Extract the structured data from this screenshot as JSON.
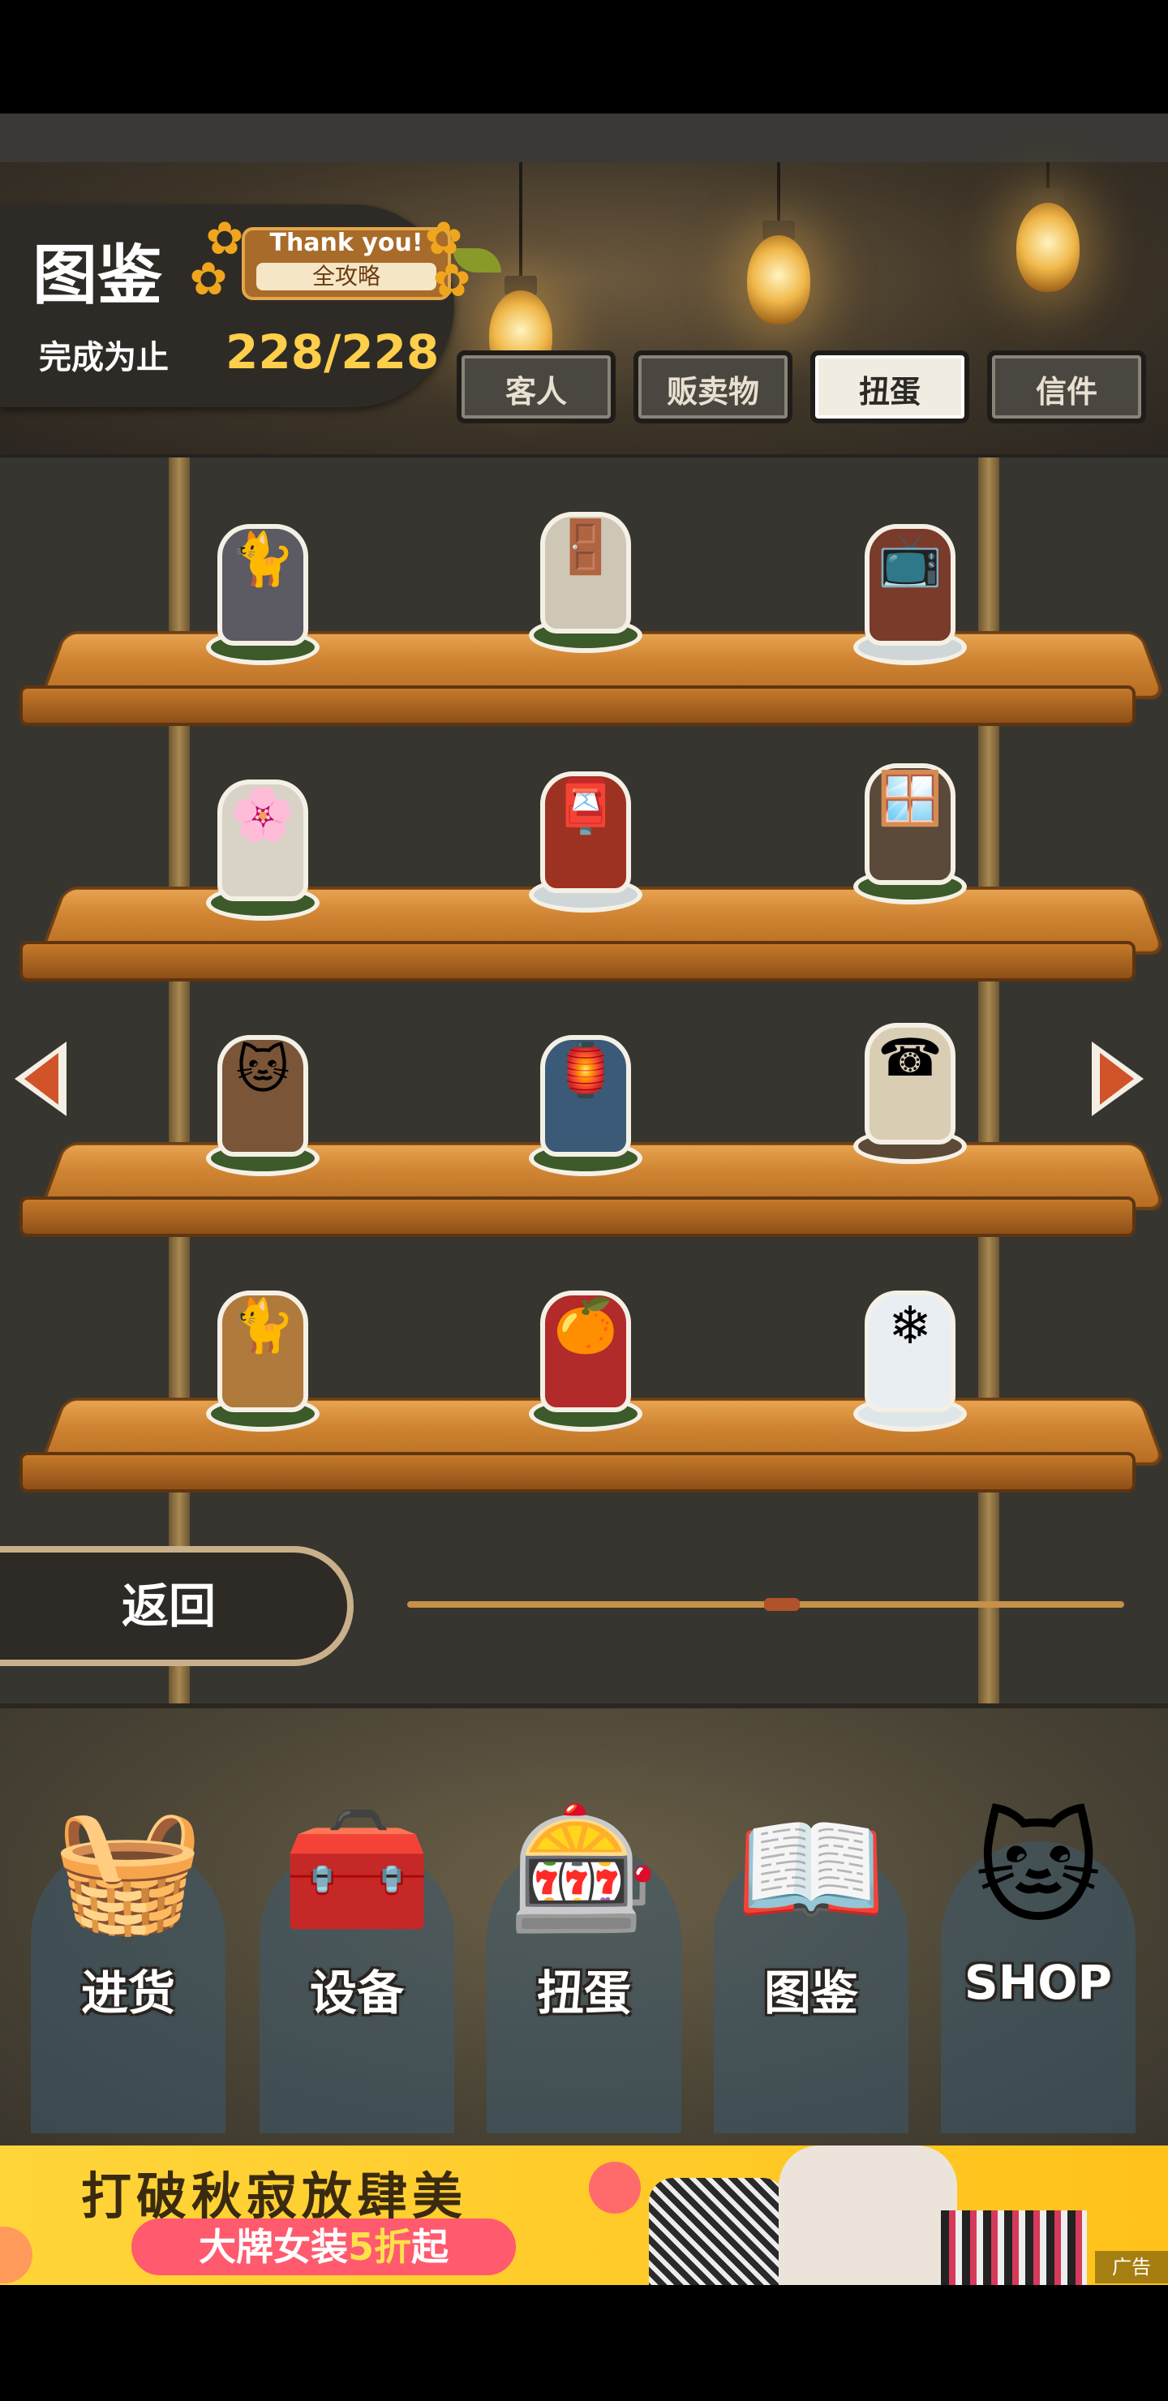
{
  "header": {
    "title": "图鉴",
    "badge_top": "Thank you!",
    "badge_sub": "全攻略",
    "progress_label": "完成为止",
    "progress_value": "228/228"
  },
  "tabs": [
    {
      "label": "客人",
      "active": false
    },
    {
      "label": "贩卖物",
      "active": false
    },
    {
      "label": "扭蛋",
      "active": true
    },
    {
      "label": "信件",
      "active": false
    }
  ],
  "shelves": [
    {
      "items": [
        {
          "icon": "cat-with-pot"
        },
        {
          "icon": "cat-at-door"
        },
        {
          "icon": "cat-on-tv"
        }
      ]
    },
    {
      "items": [
        {
          "icon": "cat-with-flowers"
        },
        {
          "icon": "cat-on-mailbox"
        },
        {
          "icon": "cat-at-window"
        }
      ]
    },
    {
      "items": [
        {
          "icon": "cat-on-table"
        },
        {
          "icon": "cat-with-lantern"
        },
        {
          "icon": "cat-at-tobacco-booth"
        }
      ]
    },
    {
      "items": [
        {
          "icon": "cat-with-bucket"
        },
        {
          "icon": "cat-under-kotatsu"
        },
        {
          "icon": "cat-in-snow"
        }
      ]
    }
  ],
  "pager": {
    "current_fraction": 0.55
  },
  "back_label": "返回",
  "nav": [
    {
      "label": "进货",
      "icon": "stock-basket-icon"
    },
    {
      "label": "设备",
      "icon": "toolbox-icon"
    },
    {
      "label": "扭蛋",
      "icon": "gacha-machine-icon"
    },
    {
      "label": "图鉴",
      "icon": "open-book-icon"
    },
    {
      "label": "SHOP",
      "icon": "lucky-cat-icon"
    }
  ],
  "ad": {
    "headline": "打破秋寂放肆美",
    "pill_prefix": "大牌女装",
    "pill_highlight": "5折",
    "pill_suffix": "起",
    "tag": "广告"
  },
  "colors": {
    "accent": "#ffcf4a",
    "arrow": "#d0532a",
    "shelf": "#d18634"
  }
}
